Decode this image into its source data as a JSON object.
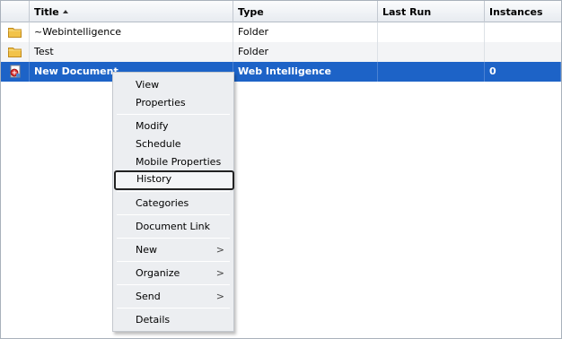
{
  "columns": {
    "title": "Title",
    "type": "Type",
    "last_run": "Last Run",
    "instances": "Instances"
  },
  "rows": [
    {
      "icon": "folder-icon",
      "title": "~Webintelligence",
      "type": "Folder",
      "last_run": "",
      "instances": ""
    },
    {
      "icon": "folder-icon",
      "title": "Test",
      "type": "Folder",
      "last_run": "",
      "instances": ""
    },
    {
      "icon": "webi-document-icon",
      "title": "New Document",
      "type": "Web Intelligence",
      "last_run": "",
      "instances": "0"
    }
  ],
  "context_menu": {
    "view": "View",
    "properties": "Properties",
    "modify": "Modify",
    "schedule": "Schedule",
    "mobile_properties": "Mobile Properties",
    "history": "History",
    "categories": "Categories",
    "document_link": "Document Link",
    "new": "New",
    "organize": "Organize",
    "send": "Send",
    "details": "Details",
    "submenu_arrow": ">"
  },
  "colors": {
    "selection": "#1d63c7",
    "folder": "#f2c34a",
    "menu_bg": "#eceef1"
  }
}
